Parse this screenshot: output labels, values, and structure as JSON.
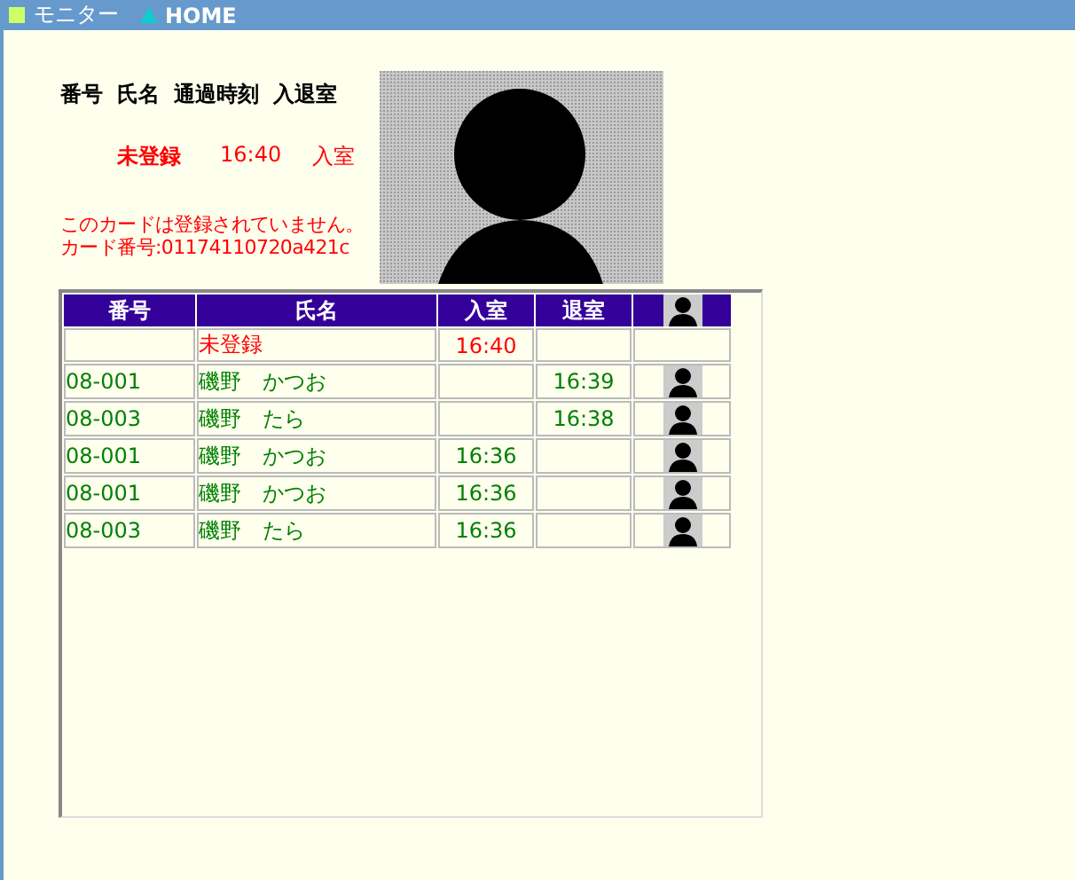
{
  "topbar": {
    "items": [
      {
        "label": "モニター",
        "kind": "square"
      },
      {
        "label": "HOME",
        "kind": "triangle"
      }
    ]
  },
  "latest": {
    "headers": [
      "番号",
      "氏名",
      "通過時刻",
      "入退室"
    ],
    "name": "未登録",
    "time": "16:40",
    "direction": "入室"
  },
  "message": [
    "このカードは登録されていません。",
    "カード番号:01174110720a421c"
  ],
  "table": {
    "columns": [
      "番号",
      "氏名",
      "入室",
      "退室"
    ],
    "rows": [
      {
        "kind": "unregistered",
        "number": "",
        "name": "未登録",
        "in": "16:40",
        "out": "",
        "photo": false
      },
      {
        "kind": "registered",
        "number": "08-001",
        "name": "磯野　かつお",
        "in": "",
        "out": "16:39",
        "photo": true
      },
      {
        "kind": "registered",
        "number": "08-003",
        "name": "磯野　たら",
        "in": "",
        "out": "16:38",
        "photo": true
      },
      {
        "kind": "registered",
        "number": "08-001",
        "name": "磯野　かつお",
        "in": "16:36",
        "out": "",
        "photo": true
      },
      {
        "kind": "registered",
        "number": "08-001",
        "name": "磯野　かつお",
        "in": "16:36",
        "out": "",
        "photo": true
      },
      {
        "kind": "registered",
        "number": "08-003",
        "name": "磯野　たら",
        "in": "16:36",
        "out": "",
        "photo": true
      }
    ]
  }
}
